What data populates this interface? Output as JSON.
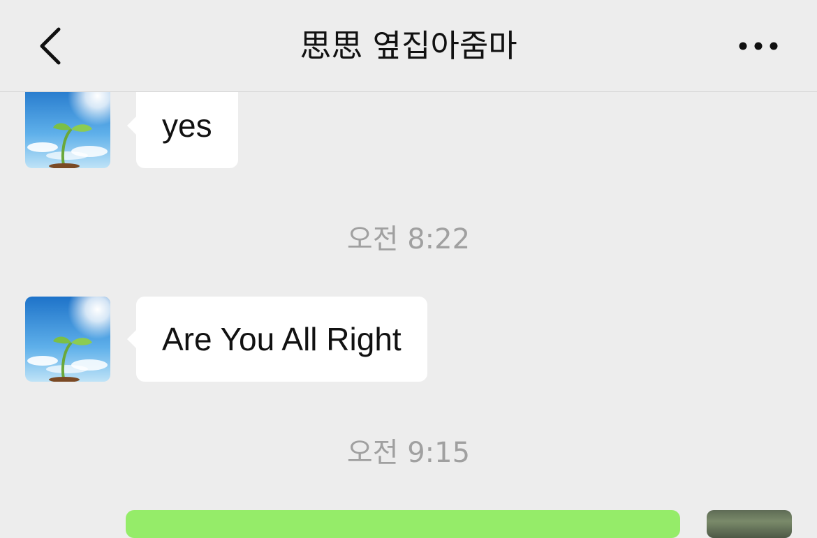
{
  "header": {
    "title": "思思 옆집아줌마",
    "back_icon": "chevron-left-icon",
    "more_icon": "more-dots-icon"
  },
  "messages": [
    {
      "sender": "contact",
      "text": "yes"
    },
    {
      "timestamp": "오전 8:22"
    },
    {
      "sender": "contact",
      "text": "Are You All Right"
    },
    {
      "timestamp": "오전 9:15"
    },
    {
      "sender": "self",
      "text": ""
    }
  ],
  "colors": {
    "background": "#ededed",
    "incoming_bubble": "#ffffff",
    "outgoing_bubble": "#95ec69",
    "timestamp_text": "#a0a0a0"
  }
}
